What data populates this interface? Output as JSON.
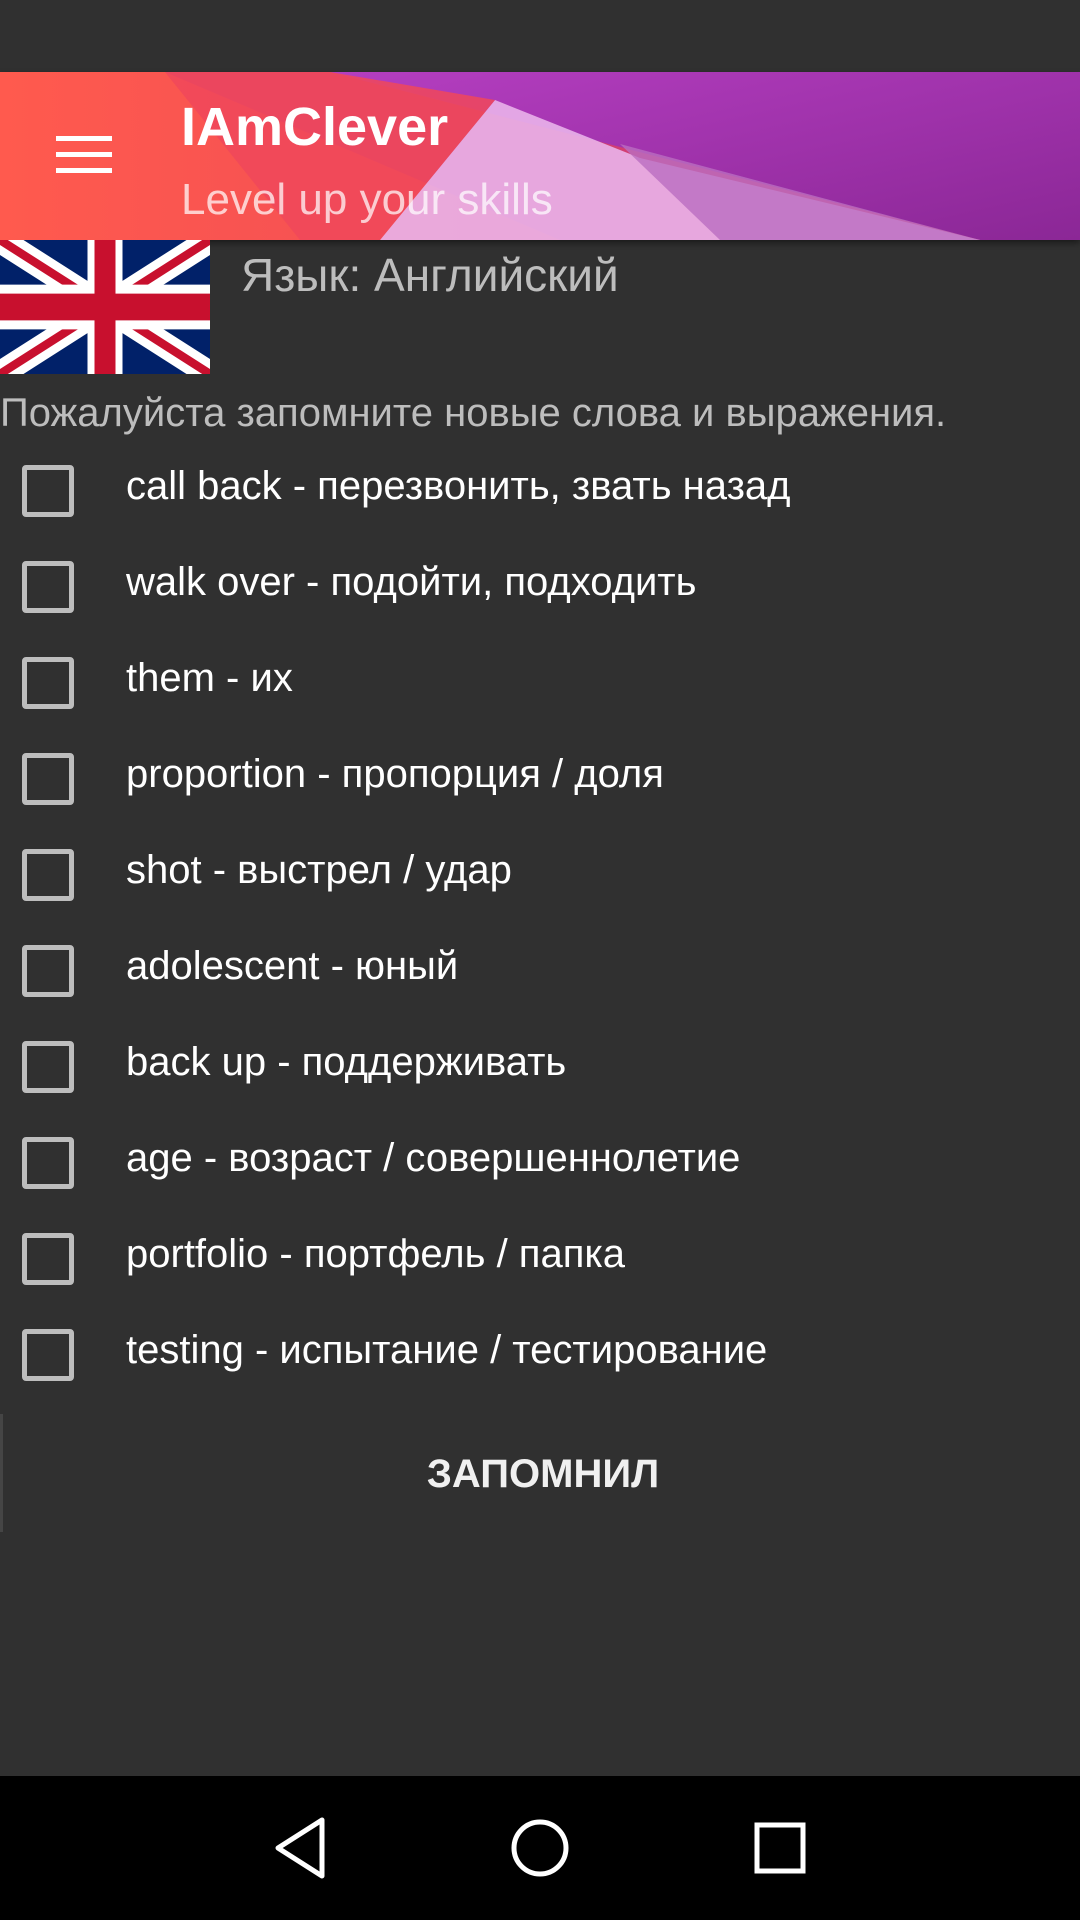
{
  "app": {
    "title": "IAmClever",
    "subtitle": "Level up your skills",
    "menu_icon": "hamburger-menu-icon"
  },
  "language": {
    "flag_icon": "uk-flag-icon",
    "label": "Язык: Английский"
  },
  "instruction": "Пожалуйста запомните новые слова и выражения.",
  "words": [
    {
      "label": "call back - перезвонить, звать назад",
      "checked": false
    },
    {
      "label": "walk over - подойти, подходить",
      "checked": false
    },
    {
      "label": "them - их",
      "checked": false
    },
    {
      "label": "proportion - пропорция / доля",
      "checked": false
    },
    {
      "label": "shot - выстрел / удар",
      "checked": false
    },
    {
      "label": "adolescent - юный",
      "checked": false
    },
    {
      "label": "back up - поддерживать",
      "checked": false
    },
    {
      "label": "age - возраст / совершеннолетие",
      "checked": false
    },
    {
      "label": "portfolio - портфель / папка",
      "checked": false
    },
    {
      "label": "testing - испытание / тестирование",
      "checked": false
    }
  ],
  "confirm_button": "ЗАПОМНИЛ",
  "nav": {
    "back_icon": "back-triangle-icon",
    "home_icon": "home-circle-icon",
    "recents_icon": "recents-square-icon"
  },
  "colors": {
    "background": "#303030",
    "header_red": "#ff5252",
    "header_purple": "#9c27b0",
    "text_primary": "#ffffff",
    "text_secondary": "#bdbdbd",
    "nav_bar": "#000000"
  }
}
